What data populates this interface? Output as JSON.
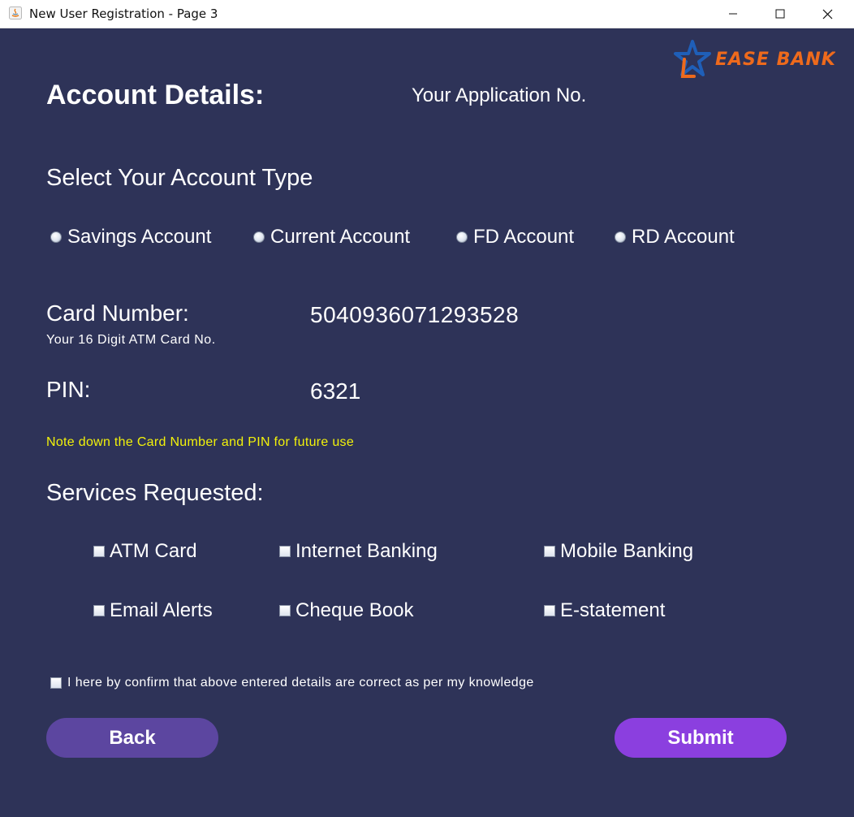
{
  "window": {
    "title": "New User Registration - Page 3"
  },
  "brand": {
    "logo_text": "EASE BANK",
    "logo_color": "#ee6a1c",
    "star_color": "#1f5fb8"
  },
  "header": {
    "heading": "Account Details:",
    "application_no_label": "Your Application No."
  },
  "account_type": {
    "heading": "Select Your Account Type",
    "options": [
      "Savings Account",
      "Current Account",
      "FD Account",
      "RD Account"
    ]
  },
  "card": {
    "label": "Card Number:",
    "sublabel": "Your 16 Digit ATM Card No.",
    "number": "5040936071293528"
  },
  "pin": {
    "label": "PIN:",
    "value": "6321"
  },
  "note": "Note down the Card Number and PIN for future use",
  "services": {
    "heading": "Services Requested:",
    "options": [
      "ATM Card",
      "Internet Banking",
      "Mobile Banking",
      "Email Alerts",
      "Cheque Book",
      "E-statement"
    ]
  },
  "confirmation": "I here by confirm that above entered details are correct as per my knowledge",
  "buttons": {
    "back": "Back",
    "submit": "Submit"
  },
  "colors": {
    "background": "#2e3358",
    "note": "#f2f20a",
    "back_button": "#5c46a0",
    "submit_button": "#8b3fdf"
  }
}
